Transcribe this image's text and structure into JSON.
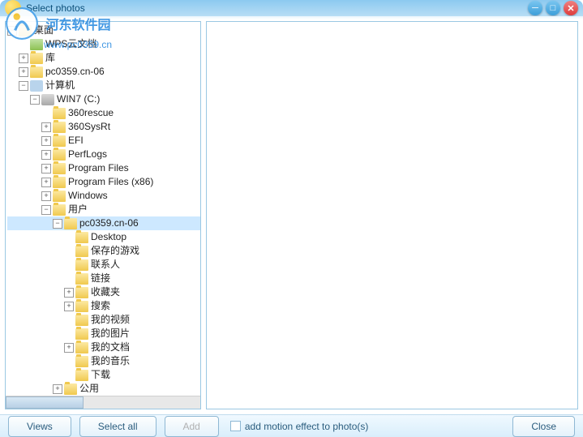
{
  "title": "Select photos",
  "watermark": {
    "name": "河东软件园",
    "url": "www.pc0359.cn"
  },
  "tree": [
    {
      "label": "桌面",
      "indent": 0,
      "tog": "-",
      "icon": "folder"
    },
    {
      "label": "WPS云文档",
      "indent": 1,
      "tog": "",
      "icon": "special"
    },
    {
      "label": "库",
      "indent": 1,
      "tog": "+",
      "icon": "folder"
    },
    {
      "label": "pc0359.cn-06",
      "indent": 1,
      "tog": "+",
      "icon": "folder"
    },
    {
      "label": "计算机",
      "indent": 1,
      "tog": "-",
      "icon": "computer"
    },
    {
      "label": "WIN7 (C:)",
      "indent": 2,
      "tog": "-",
      "icon": "drive"
    },
    {
      "label": "360rescue",
      "indent": 3,
      "tog": "",
      "icon": "folder"
    },
    {
      "label": "360SysRt",
      "indent": 3,
      "tog": "+",
      "icon": "folder"
    },
    {
      "label": "EFI",
      "indent": 3,
      "tog": "+",
      "icon": "folder"
    },
    {
      "label": "PerfLogs",
      "indent": 3,
      "tog": "+",
      "icon": "folder"
    },
    {
      "label": "Program Files",
      "indent": 3,
      "tog": "+",
      "icon": "folder"
    },
    {
      "label": "Program Files (x86)",
      "indent": 3,
      "tog": "+",
      "icon": "folder"
    },
    {
      "label": "Windows",
      "indent": 3,
      "tog": "+",
      "icon": "folder"
    },
    {
      "label": "用户",
      "indent": 3,
      "tog": "-",
      "icon": "folder"
    },
    {
      "label": "pc0359.cn-06",
      "indent": 4,
      "tog": "-",
      "icon": "folder",
      "selected": true
    },
    {
      "label": "Desktop",
      "indent": 5,
      "tog": "",
      "icon": "folder"
    },
    {
      "label": "保存的游戏",
      "indent": 5,
      "tog": "",
      "icon": "folder"
    },
    {
      "label": "联系人",
      "indent": 5,
      "tog": "",
      "icon": "folder"
    },
    {
      "label": "链接",
      "indent": 5,
      "tog": "",
      "icon": "folder"
    },
    {
      "label": "收藏夹",
      "indent": 5,
      "tog": "+",
      "icon": "folder"
    },
    {
      "label": "搜索",
      "indent": 5,
      "tog": "+",
      "icon": "folder"
    },
    {
      "label": "我的视频",
      "indent": 5,
      "tog": "",
      "icon": "folder"
    },
    {
      "label": "我的图片",
      "indent": 5,
      "tog": "",
      "icon": "folder"
    },
    {
      "label": "我的文档",
      "indent": 5,
      "tog": "+",
      "icon": "folder"
    },
    {
      "label": "我的音乐",
      "indent": 5,
      "tog": "",
      "icon": "folder"
    },
    {
      "label": "下载",
      "indent": 5,
      "tog": "",
      "icon": "folder"
    },
    {
      "label": "公用",
      "indent": 4,
      "tog": "+",
      "icon": "folder"
    }
  ],
  "footer": {
    "views": "Views",
    "select_all": "Select all",
    "add": "Add",
    "motion_label": "add motion effect to photo(s)",
    "close": "Close"
  }
}
